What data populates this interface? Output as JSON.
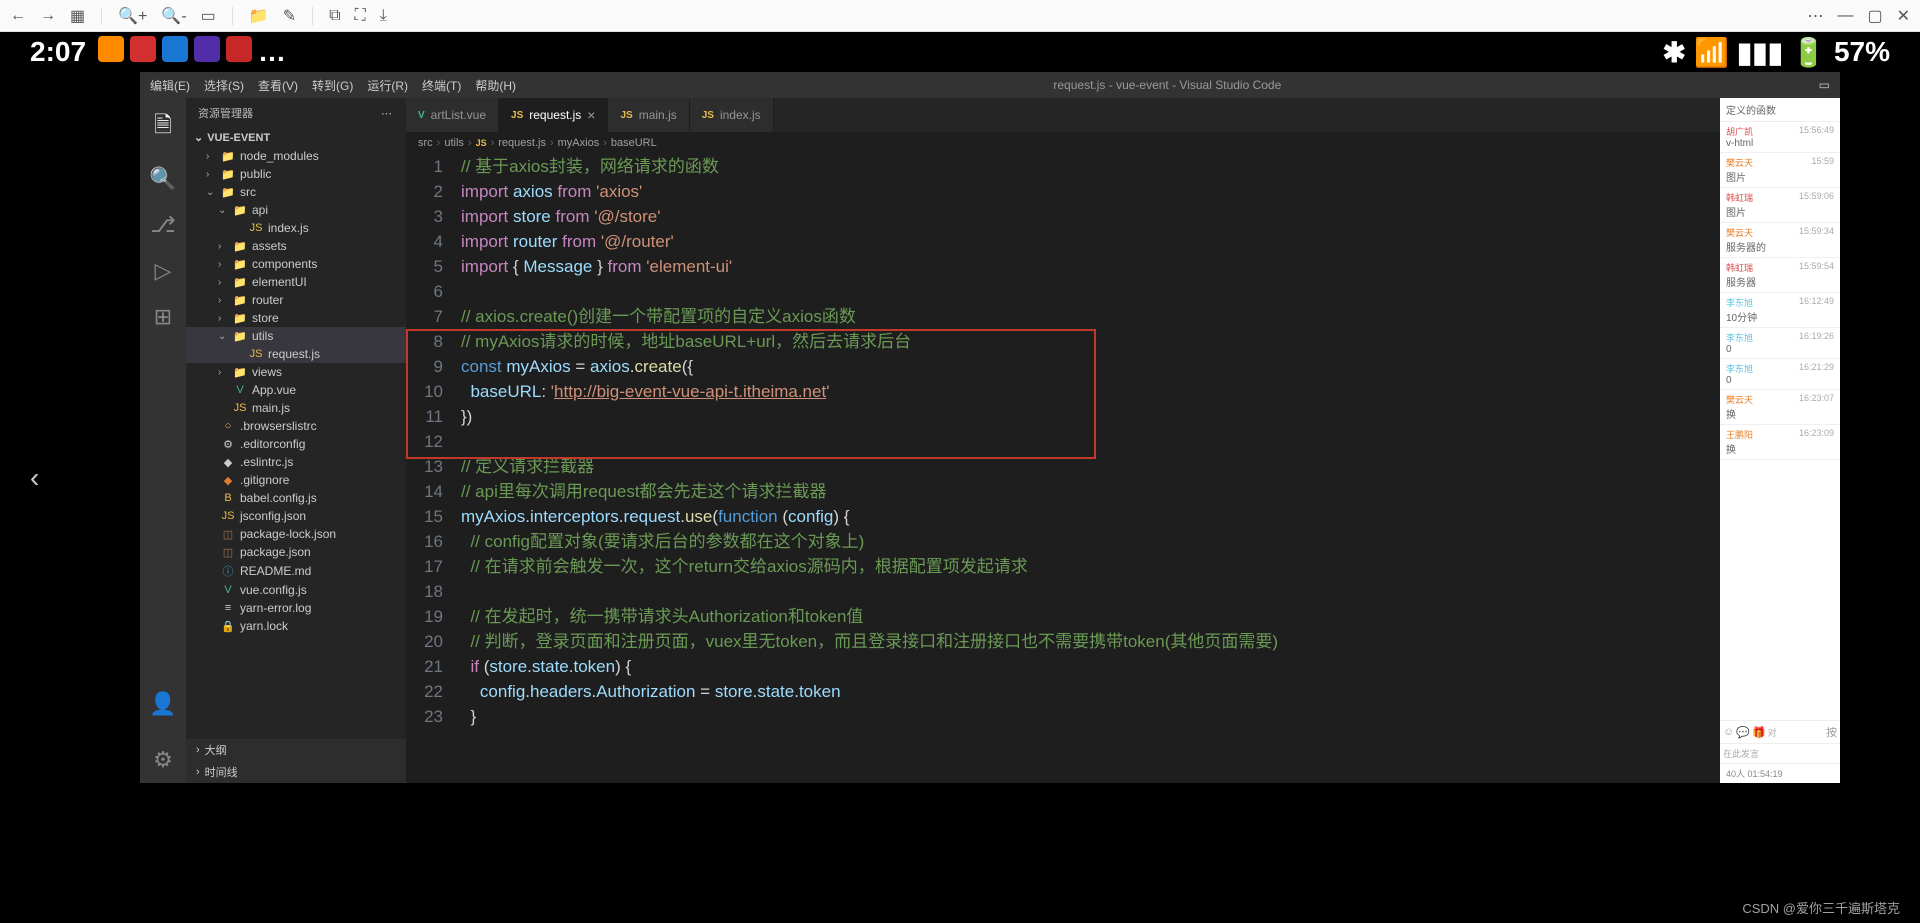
{
  "toolbar": {},
  "phone": {
    "time": "2:07",
    "battery": "57%"
  },
  "vscode": {
    "menus": [
      "编辑(E)",
      "选择(S)",
      "查看(V)",
      "转到(G)",
      "运行(R)",
      "终端(T)",
      "帮助(H)"
    ],
    "title": "request.js - vue-event - Visual Studio Code",
    "sidebar_title": "资源管理器",
    "project": "VUE-EVENT",
    "tree": [
      {
        "label": "node_modules",
        "type": "folder",
        "chev": "›",
        "indent": 12,
        "cls": "folder-icon"
      },
      {
        "label": "public",
        "type": "folder",
        "chev": "›",
        "indent": 12,
        "cls": "folder-icon"
      },
      {
        "label": "src",
        "type": "folder",
        "chev": "⌄",
        "indent": 12,
        "cls": "folder-icon"
      },
      {
        "label": "api",
        "type": "folder",
        "chev": "⌄",
        "indent": 24,
        "cls": "folder-icon"
      },
      {
        "label": "index.js",
        "type": "file",
        "chev": "",
        "indent": 40,
        "cls": "yellow-icon",
        "pre": "JS"
      },
      {
        "label": "assets",
        "type": "folder",
        "chev": "›",
        "indent": 24,
        "cls": "folder-icon"
      },
      {
        "label": "components",
        "type": "folder",
        "chev": "›",
        "indent": 24,
        "cls": "folder-icon"
      },
      {
        "label": "elementUI",
        "type": "folder",
        "chev": "›",
        "indent": 24,
        "cls": "folder-icon"
      },
      {
        "label": "router",
        "type": "folder",
        "chev": "›",
        "indent": 24,
        "cls": "folder-icon"
      },
      {
        "label": "store",
        "type": "folder",
        "chev": "›",
        "indent": 24,
        "cls": "folder-icon"
      },
      {
        "label": "utils",
        "type": "folder",
        "chev": "⌄",
        "indent": 24,
        "cls": "folder-icon",
        "selected": true
      },
      {
        "label": "request.js",
        "type": "file",
        "chev": "",
        "indent": 40,
        "cls": "yellow-icon",
        "pre": "JS",
        "selected": true
      },
      {
        "label": "views",
        "type": "folder",
        "chev": "›",
        "indent": 24,
        "cls": "folder-icon"
      },
      {
        "label": "App.vue",
        "type": "file",
        "chev": "",
        "indent": 24,
        "cls": "green-icon",
        "pre": "V"
      },
      {
        "label": "main.js",
        "type": "file",
        "chev": "",
        "indent": 24,
        "cls": "yellow-icon",
        "pre": "JS"
      },
      {
        "label": ".browserslistrc",
        "type": "file",
        "chev": "",
        "indent": 12,
        "cls": "yellow-icon",
        "pre": "○"
      },
      {
        "label": ".editorconfig",
        "type": "file",
        "chev": "",
        "indent": 12,
        "cls": "",
        "pre": "⚙"
      },
      {
        "label": ".eslintrc.js",
        "type": "file",
        "chev": "",
        "indent": 12,
        "cls": "",
        "pre": "◆"
      },
      {
        "label": ".gitignore",
        "type": "file",
        "chev": "",
        "indent": 12,
        "cls": "orange-icon",
        "pre": "◆"
      },
      {
        "label": "babel.config.js",
        "type": "file",
        "chev": "",
        "indent": 12,
        "cls": "yellow-icon",
        "pre": "B"
      },
      {
        "label": "jsconfig.json",
        "type": "file",
        "chev": "",
        "indent": 12,
        "cls": "yellow-icon",
        "pre": "JS"
      },
      {
        "label": "package-lock.json",
        "type": "file",
        "chev": "",
        "indent": 12,
        "cls": "brown-icon",
        "pre": "◫"
      },
      {
        "label": "package.json",
        "type": "file",
        "chev": "",
        "indent": 12,
        "cls": "brown-icon",
        "pre": "◫"
      },
      {
        "label": "README.md",
        "type": "file",
        "chev": "",
        "indent": 12,
        "cls": "blue-icon",
        "pre": "ⓘ"
      },
      {
        "label": "vue.config.js",
        "type": "file",
        "chev": "",
        "indent": 12,
        "cls": "green-icon",
        "pre": "V"
      },
      {
        "label": "yarn-error.log",
        "type": "file",
        "chev": "",
        "indent": 12,
        "cls": "",
        "pre": "≡"
      },
      {
        "label": "yarn.lock",
        "type": "file",
        "chev": "",
        "indent": 12,
        "cls": "",
        "pre": "🔒"
      }
    ],
    "outline_label": "大纲",
    "timeline_label": "时间线",
    "tabs": [
      {
        "label": "artList.vue",
        "icon": "V",
        "icolor": "green-icon"
      },
      {
        "label": "request.js",
        "icon": "JS",
        "icolor": "yellow-icon",
        "active": true,
        "close": "×"
      },
      {
        "label": "main.js",
        "icon": "JS",
        "icolor": "yellow-icon"
      },
      {
        "label": "index.js",
        "icon": "JS",
        "icolor": "yellow-icon"
      }
    ],
    "breadcrumb": [
      "src",
      "utils",
      "JS",
      "request.js",
      "myAxios",
      "baseURL"
    ],
    "code": [
      "<span class='tk-co'>// 基于axios封装，网络请求的函数</span>",
      "<span class='tk-kw'>import</span> <span class='tk-va'>axios</span> <span class='tk-kw'>from</span> <span class='tk-st'>'axios'</span>",
      "<span class='tk-kw'>import</span> <span class='tk-va'>store</span> <span class='tk-kw'>from</span> <span class='tk-st'>'@/store'</span>",
      "<span class='tk-kw'>import</span> <span class='tk-va'>router</span> <span class='tk-kw'>from</span> <span class='tk-st'>'@/router'</span>",
      "<span class='tk-kw'>import</span> <span class='tk-op'>{</span> <span class='tk-va'>Message</span> <span class='tk-op'>}</span> <span class='tk-kw'>from</span> <span class='tk-st'>'element-ui'</span>",
      "",
      "<span class='tk-co'>// axios.create()创建一个带配置项的自定义axios函数</span>",
      "<span class='tk-co'>// myAxios请求的时候，地址baseURL+url，然后去请求后台</span>",
      "<span class='tk-bl'>const</span> <span class='tk-va'>myAxios</span> <span class='tk-op'>=</span> <span class='tk-va'>axios</span><span class='tk-op'>.</span><span class='tk-fn'>create</span><span class='tk-op'>({</span>",
      "  <span class='tk-va'>baseURL</span><span class='tk-op'>:</span> <span class='tk-st'>'</span><span class='tk-url'>http://big-event-vue-api-t.itheima.net</span><span class='tk-st'>'</span>",
      "<span class='tk-op'>})</span>",
      "",
      "<span class='tk-co'>// 定义请求拦截器</span>",
      "<span class='tk-co'>// api里每次调用request都会先走这个请求拦截器</span>",
      "<span class='tk-va'>myAxios</span><span class='tk-op'>.</span><span class='tk-va'>interceptors</span><span class='tk-op'>.</span><span class='tk-va'>request</span><span class='tk-op'>.</span><span class='tk-fn'>use</span><span class='tk-op'>(</span><span class='tk-bl'>function</span> <span class='tk-op'>(</span><span class='tk-va'>config</span><span class='tk-op'>) {</span>",
      "  <span class='tk-co'>// config配置对象(要请求后台的参数都在这个对象上)</span>",
      "  <span class='tk-co'>// 在请求前会触发一次，这个return交给axios源码内，根据配置项发起请求</span>",
      "",
      "  <span class='tk-co'>// 在发起时，统一携带请求头Authorization和token值</span>",
      "  <span class='tk-co'>// 判断，登录页面和注册页面，vuex里无token，而且登录接口和注册接口也不需要携带token(其他页面需要)</span>",
      "  <span class='tk-kw'>if</span> <span class='tk-op'>(</span><span class='tk-va'>store</span><span class='tk-op'>.</span><span class='tk-va'>state</span><span class='tk-op'>.</span><span class='tk-va'>token</span><span class='tk-op'>) {</span>",
      "    <span class='tk-va'>config</span><span class='tk-op'>.</span><span class='tk-va'>headers</span><span class='tk-op'>.</span><span class='tk-va'>Authorization</span> <span class='tk-op'>=</span> <span class='tk-va'>store</span><span class='tk-op'>.</span><span class='tk-va'>state</span><span class='tk-op'>.</span><span class='tk-va'>token</span>",
      "  <span class='tk-op'>}</span>"
    ]
  },
  "chat": {
    "header": "定义的函数",
    "msgs": [
      {
        "u": "胡广凯",
        "c": "",
        "t": "15:56:49",
        "txt": "v-html"
      },
      {
        "u": "樊云天",
        "c": "orange",
        "t": "15:59",
        "txt": "图片"
      },
      {
        "u": "韩虹瑞",
        "c": "",
        "t": "15:59:06",
        "txt": "图片"
      },
      {
        "u": "樊云天",
        "c": "orange",
        "t": "15:59:34",
        "txt": "服务器的"
      },
      {
        "u": "韩虹瑞",
        "c": "",
        "t": "15:59:54",
        "txt": "服务器"
      },
      {
        "u": "李东旭",
        "c": "blue",
        "t": "16:12:49",
        "txt": "10分钟"
      },
      {
        "u": "李东旭",
        "c": "blue",
        "t": "16:19:26",
        "txt": "0"
      },
      {
        "u": "李东旭",
        "c": "blue",
        "t": "16:21:29",
        "txt": "0"
      },
      {
        "u": "樊云天",
        "c": "orange",
        "t": "16:23:07",
        "txt": "换"
      },
      {
        "u": "王鹏阳",
        "c": "orange",
        "t": "16:23:09",
        "txt": "换"
      }
    ],
    "input_ph": "在此发言",
    "footer": "40人  01:54:19"
  },
  "watermark": "CSDN @爱你三千遍斯塔克"
}
